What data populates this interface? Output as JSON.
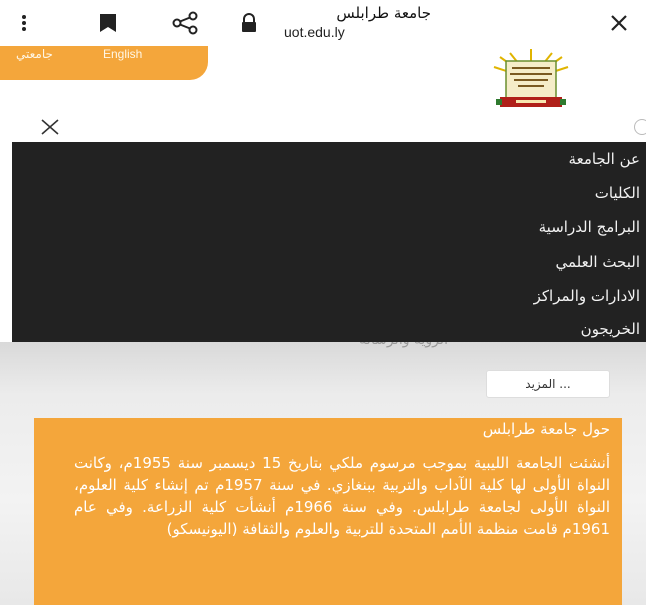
{
  "browser": {
    "title": "جامعة طرابلس",
    "url": "uot.edu.ly"
  },
  "header": {
    "lang_english": "English",
    "lang_arabic": "جامعتي"
  },
  "menu": {
    "items": [
      {
        "label": "عن الجامعة"
      },
      {
        "label": "الكليات"
      },
      {
        "label": "البرامج الدراسية"
      },
      {
        "label": "البحث العلمي"
      },
      {
        "label": "الادارات والمراكز"
      },
      {
        "label": "الخريجون"
      }
    ]
  },
  "content": {
    "behind_text": "الرؤية والرسالة",
    "more_button": "المزيد ...",
    "about_title": "حول جامعة طرابلس",
    "about_text": "أنشئت الجامعة الليبية بموجب مرسوم ملكي بتاريخ 15 ديسمبر سنة 1955م، وكانت النواة الأولى لها كلية الآداب والتربية ببنغازي. في سنة 1957م تم إنشاء كلية العلوم، النواة الأولى لجامعة طرابلس. وفي سنة 1966م أنشأت كلية الزراعة. وفي عام 1961م قامت منظمة الأمم المتحدة للتربية والعلوم والثقافة (اليونيسكو)"
  },
  "colors": {
    "accent": "#f4a63b",
    "menu_bg": "#222222"
  }
}
